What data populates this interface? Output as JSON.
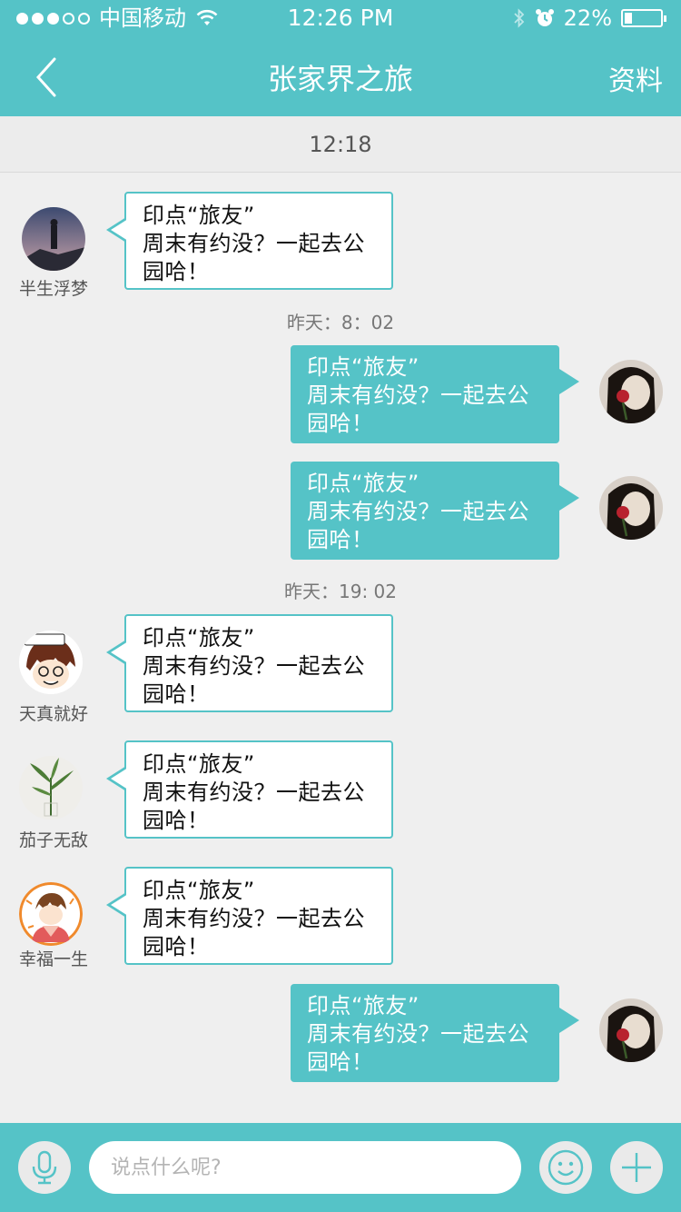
{
  "status_bar": {
    "carrier": "中国移动",
    "time": "12:26 PM",
    "battery": "22%",
    "battery_level": 0.22
  },
  "nav": {
    "title": "张家界之旅",
    "right_label": "资料"
  },
  "top_timestamp": "12:18",
  "separators": [
    "昨天：8：02",
    "昨天：19: 02"
  ],
  "message_lines": [
    "印点“旅友”",
    "周末有约没？一起去公",
    "园哈！"
  ],
  "contacts": {
    "c1": "半生浮梦",
    "c2": "天真就好",
    "c3": "茄子无敌",
    "c4": "幸福一生"
  },
  "input": {
    "placeholder": "说点什么呢?"
  },
  "colors": {
    "accent": "#55c3c7",
    "background": "#efefef"
  },
  "icons": [
    "back-icon",
    "wifi-icon",
    "bluetooth-icon",
    "alarm-icon",
    "battery-icon",
    "microphone-icon",
    "emoji-icon",
    "plus-icon"
  ]
}
